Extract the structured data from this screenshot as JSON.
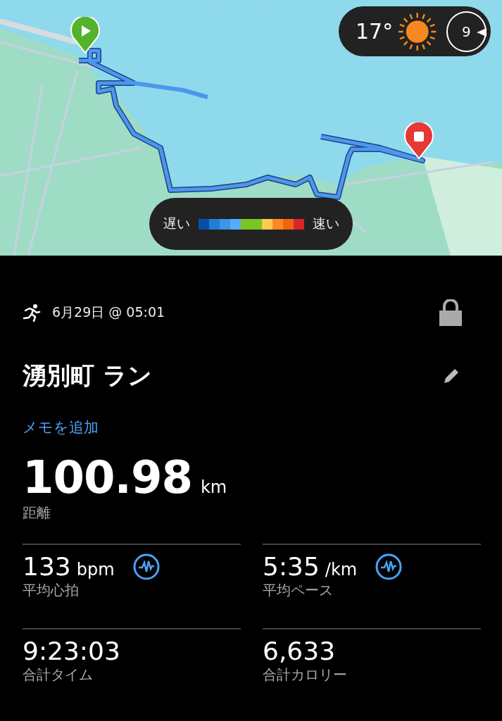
{
  "map": {
    "weather": {
      "temperature": "17°",
      "wind_speed": "9"
    },
    "legend": {
      "slow_label": "遅い",
      "fast_label": "速い",
      "swatches": [
        {
          "color": "#0a4fa6"
        },
        {
          "color": "#1f7fd8"
        },
        {
          "color": "#3b95ea"
        },
        {
          "color": "#56acf7"
        },
        {
          "color": "#7cc522"
        },
        {
          "color": "#7cc522"
        },
        {
          "color": "#fdca4a"
        },
        {
          "color": "#fb8a22"
        },
        {
          "color": "#ec6510"
        },
        {
          "color": "#d8262a"
        }
      ]
    }
  },
  "activity": {
    "date": "6月29日 @ 05:01",
    "title": "湧別町 ラン",
    "add_note": "メモを追加",
    "distance": {
      "value": "100.98",
      "unit": "km",
      "label": "距離"
    },
    "stats": [
      {
        "value": "133",
        "unit": "bpm",
        "label": "平均心拍",
        "kind": "graph"
      },
      {
        "value": "5:35",
        "unit": "/km",
        "label": "平均ペース",
        "kind": "graph"
      },
      {
        "value": "9:23:03",
        "label": "合計タイム",
        "kind": "plain"
      },
      {
        "value": "6,633",
        "label": "合計カロリー",
        "kind": "plain"
      }
    ]
  }
}
